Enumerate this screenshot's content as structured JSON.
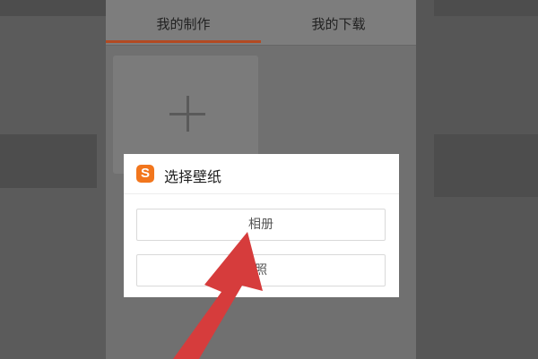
{
  "tabs": [
    {
      "label": "我的制作",
      "active": true
    },
    {
      "label": "我的下载",
      "active": false
    }
  ],
  "dialog": {
    "logo_letter": "S",
    "title": "选择壁纸",
    "options": [
      "相册",
      "照"
    ]
  },
  "colors": {
    "accent": "#b34a22",
    "logo": "#f2761d",
    "arrow": "#d63c3c"
  },
  "icons": {
    "add": "plus-icon",
    "logo": "sogou-logo-icon"
  }
}
